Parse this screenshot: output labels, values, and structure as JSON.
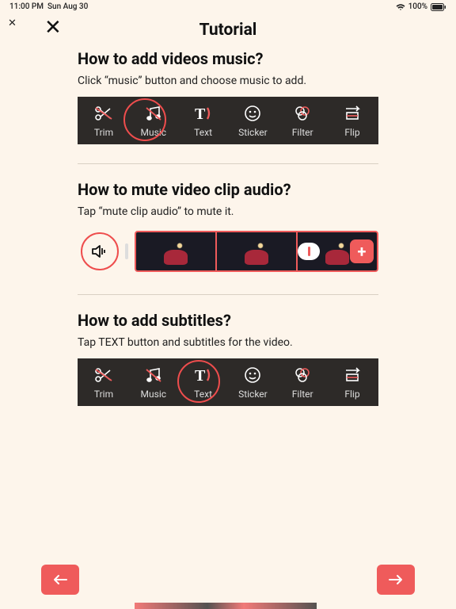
{
  "statusbar": {
    "time": "11:00 PM",
    "date": "Sun Aug 30",
    "battery": "100%"
  },
  "header": {
    "title": "Tutorial"
  },
  "sections": [
    {
      "heading": "How to add videos music?",
      "body": "Click “music” button and choose music to add."
    },
    {
      "heading": "How to mute video clip audio?",
      "body": "Tap “mute clip audio” to mute it."
    },
    {
      "heading": "How to add subtitles?",
      "body": "Tap TEXT button and subtitles for the video."
    }
  ],
  "tools": {
    "trim": "Trim",
    "music": "Music",
    "text": "Text",
    "sticker": "Sticker",
    "filter": "Filter",
    "flip": "Flip"
  }
}
